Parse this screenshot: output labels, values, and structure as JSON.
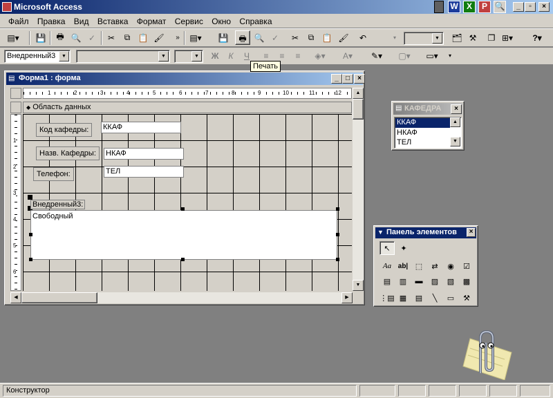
{
  "app": {
    "title": "Microsoft Access"
  },
  "menu": {
    "items": [
      "Файл",
      "Правка",
      "Вид",
      "Вставка",
      "Формат",
      "Сервис",
      "Окно",
      "Справка"
    ]
  },
  "toolbar2": {
    "control_combo": "Внедренный3"
  },
  "tooltip": {
    "text": "Печать"
  },
  "form_window": {
    "title": "Форма1 : форма",
    "section": "Область данных",
    "ruler_numbers": [
      "1",
      "2",
      "3",
      "4",
      "5",
      "6",
      "7",
      "8",
      "9",
      "10",
      "11",
      "12"
    ],
    "vruler_numbers": [
      "1",
      "2",
      "3",
      "4",
      "5",
      "6"
    ],
    "controls": [
      {
        "label": "Код кафедры:",
        "value": "ККАФ"
      },
      {
        "label": "Назв. Кафедры:",
        "value": "НКАФ"
      },
      {
        "label": "Телефон:",
        "value": "ТЕЛ"
      }
    ],
    "embedded_label": "Внедренный3:",
    "embedded_content": "Свободный"
  },
  "field_list": {
    "title": "КАФЕДРА",
    "items": [
      "ККАФ",
      "НКАФ",
      "ТЕЛ"
    ],
    "selected": "ККАФ"
  },
  "toolbox": {
    "title": "Панель элементов",
    "label_glyph": "Aa",
    "textbox_glyph": "ab|"
  },
  "status": {
    "text": "Конструктор"
  },
  "colors": {
    "title_active": "#0a246a",
    "title_gradient": "#a6caf0",
    "face": "#d4d0c8",
    "workspace": "#808080"
  }
}
